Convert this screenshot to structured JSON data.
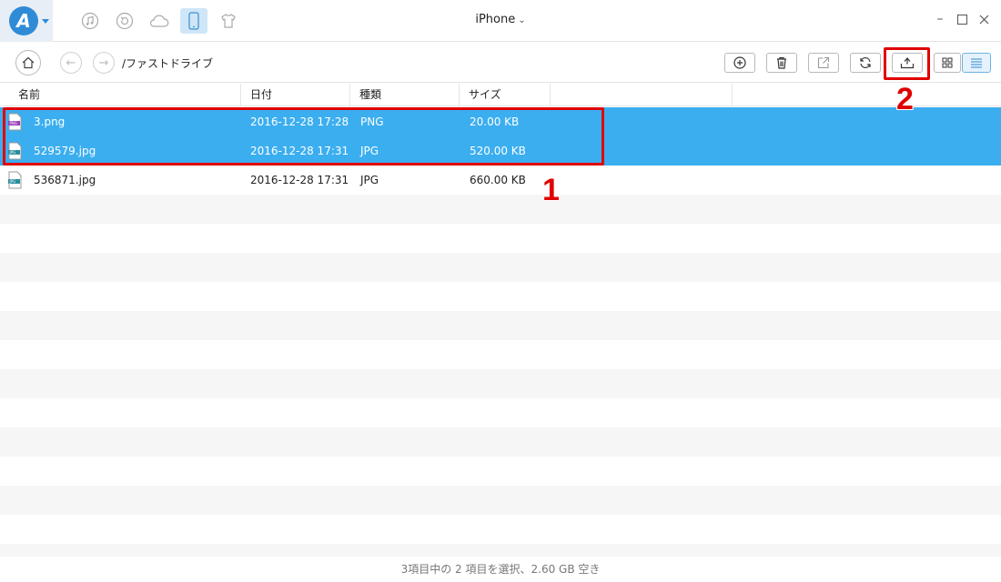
{
  "app": {
    "logo_letter": "A",
    "device_name": "iPhone"
  },
  "toolbar": {
    "path": "/ファストドライブ"
  },
  "table": {
    "columns": [
      "名前",
      "日付",
      "種類",
      "サイズ"
    ],
    "rows": [
      {
        "name": "3.png",
        "date": "2016-12-28 17:28",
        "type": "PNG",
        "size": "20.00 KB",
        "selected": true,
        "icon": "png-file-icon"
      },
      {
        "name": "529579.jpg",
        "date": "2016-12-28 17:31",
        "type": "JPG",
        "size": "520.00 KB",
        "selected": true,
        "icon": "jpg-file-icon"
      },
      {
        "name": "536871.jpg",
        "date": "2016-12-28 17:31",
        "type": "JPG",
        "size": "660.00 KB",
        "selected": false,
        "icon": "jpg-file-icon"
      }
    ]
  },
  "callouts": {
    "one": "1",
    "two": "2"
  },
  "status": {
    "text": "3項目中の 2 項目を選択、2.60 GB 空き"
  },
  "colors": {
    "accent": "#3baef0",
    "highlight": "#e00000"
  }
}
